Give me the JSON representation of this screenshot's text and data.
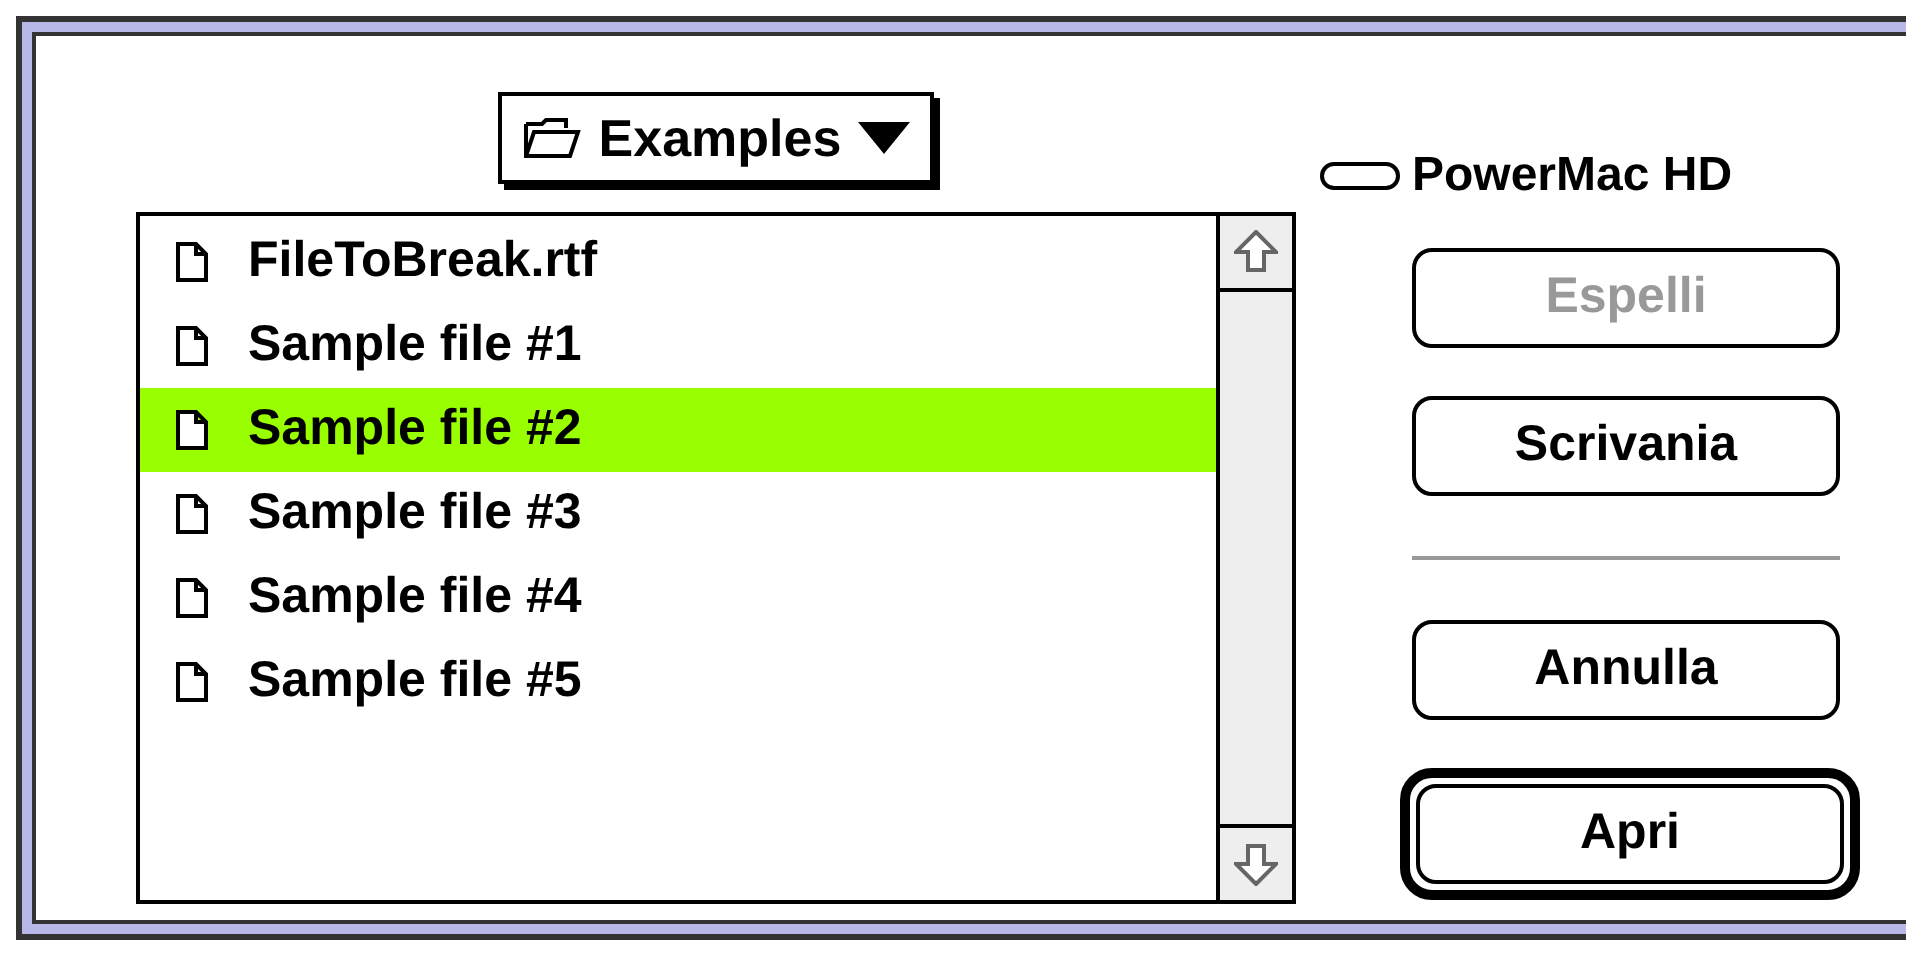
{
  "folder_popup": {
    "label": "Examples"
  },
  "disk": {
    "label": "PowerMac HD"
  },
  "files": [
    {
      "name": "FileToBreak.rtf",
      "selected": false
    },
    {
      "name": "Sample file #1",
      "selected": false
    },
    {
      "name": "Sample file #2",
      "selected": true
    },
    {
      "name": "Sample file #3",
      "selected": false
    },
    {
      "name": "Sample file #4",
      "selected": false
    },
    {
      "name": "Sample file #5",
      "selected": false
    }
  ],
  "buttons": [
    {
      "label": "Espelli",
      "disabled": true,
      "default": false
    },
    {
      "label": "Scrivania",
      "disabled": false,
      "default": false
    },
    {
      "kind": "divider"
    },
    {
      "label": "Annulla",
      "disabled": false,
      "default": false
    },
    {
      "label": "Apri",
      "disabled": false,
      "default": true
    }
  ]
}
